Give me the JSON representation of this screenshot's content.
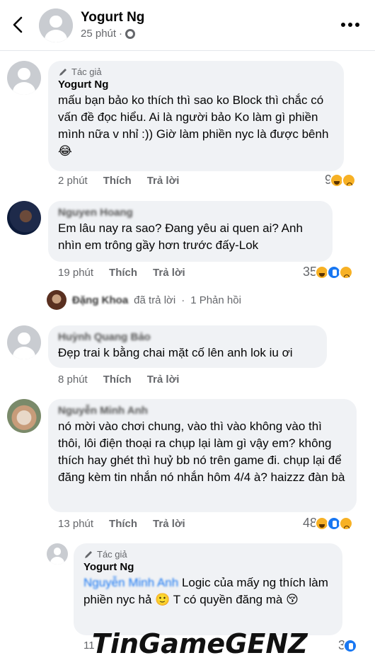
{
  "header": {
    "name": "Yogurt Ng",
    "time": "25 phút",
    "separator": "·"
  },
  "comments": [
    {
      "author_tag": "Tác giả",
      "name": "Yogurt Ng",
      "text": "mấu bạn bảo ko thích thì sao ko Block thì chắc có vấn đề đọc hiểu. Ai là người bảo Ko làm gì phiền mình nữa v nhỉ :)) Giờ làm phiền nyc là được bênh 😂",
      "time": "2 phút",
      "like": "Thích",
      "reply": "Trả lời",
      "reactions_count": "9",
      "reactions": [
        "haha",
        "sad"
      ]
    },
    {
      "name": "Nguyen Hoang",
      "text": "Em lâu nay ra sao? Đang yêu ai quen ai? Anh nhìn em trông gầy hơn trước đấy-Lok",
      "time": "19 phút",
      "like": "Thích",
      "reply": "Trả lời",
      "reactions_count": "35",
      "reactions": [
        "haha",
        "like",
        "sad"
      ],
      "replies_row": {
        "replier": "Đặng Khoa",
        "replied": "đã trả lời",
        "separator": "·",
        "count": "1 Phản hồi"
      }
    },
    {
      "name": "Huỳnh Quang Bảo",
      "text": "Đẹp trai k bằng chai mặt cố lên anh lok iu ơi",
      "time": "8 phút",
      "like": "Thích",
      "reply": "Trả lời"
    },
    {
      "name": "Nguyễn Minh Anh",
      "text": "nó mời vào chơi chung, vào thì vào không vào thì thôi, lôi điện thoại ra chụp lại làm gì vậy em? không thích hay ghét thì huỷ bb nó trên game đi. chụp lại để đăng kèm tin nhắn nó nhắn hôm 4/4 à? haizzz đàn bà",
      "time": "13 phút",
      "like": "Thích",
      "reply": "Trả lời",
      "reactions_count": "48",
      "reactions": [
        "haha",
        "like",
        "sad"
      ]
    },
    {
      "author_tag": "Tác giả",
      "name": "Yogurt Ng",
      "mention": "Nguyễn Minh Anh",
      "text": "Logic của mấy ng thích làm phiền nyc hả 🙂 T có quyền đăng mà 😚",
      "time": "11",
      "reactions_count": "3",
      "reactions": [
        "like"
      ]
    }
  ],
  "watermark": "TinGameGENZ"
}
